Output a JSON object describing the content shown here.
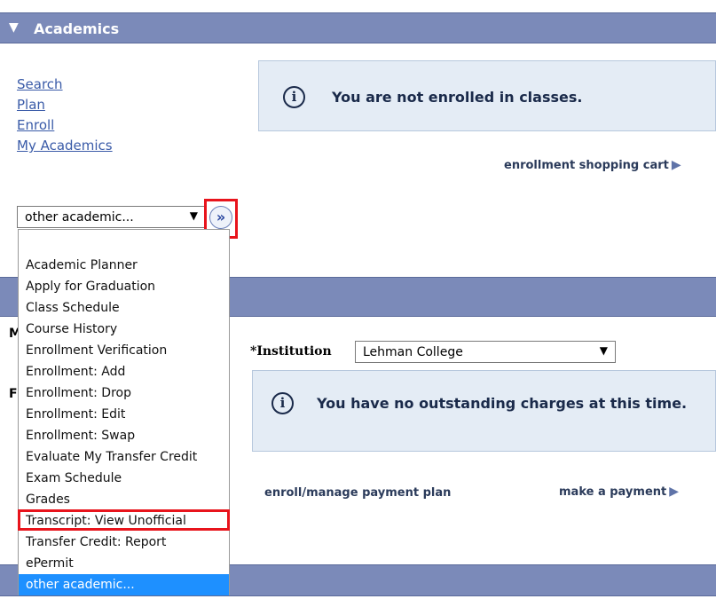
{
  "academics": {
    "title": "Academics",
    "nav_links": [
      "Search",
      "Plan",
      "Enroll",
      "My Academics"
    ],
    "enroll_alert": "You are not enrolled in classes.",
    "cart_link": "enrollment shopping cart",
    "select_value": "other academic...",
    "go_icon": "double-chevron-right-icon"
  },
  "dropdown": {
    "options": [
      "Academic Planner",
      "Apply for Graduation",
      "Class Schedule",
      "Course History",
      "Enrollment Verification",
      "Enrollment: Add",
      "Enrollment: Drop",
      "Enrollment: Edit",
      "Enrollment: Swap",
      "Evaluate My Transfer Credit",
      "Exam Schedule",
      "Grades",
      "Transcript: View Unofficial",
      "Transfer Credit: Report",
      "ePermit",
      "other academic..."
    ],
    "selected": "other academic...",
    "highlighted_option": "Transcript: View Unofficial"
  },
  "finances": {
    "institution_label": "*Institution",
    "institution_value": "Lehman College",
    "charges_alert": "You have no outstanding charges at this time.",
    "plan_link": "enroll/manage payment plan",
    "pay_link": "make a payment"
  },
  "colors": {
    "header_bg": "#7b8ab9",
    "alert_bg": "#e4ecf5",
    "link": "#3a5ba8",
    "highlight": "#e8141c",
    "selected_option": "#1e90ff"
  }
}
